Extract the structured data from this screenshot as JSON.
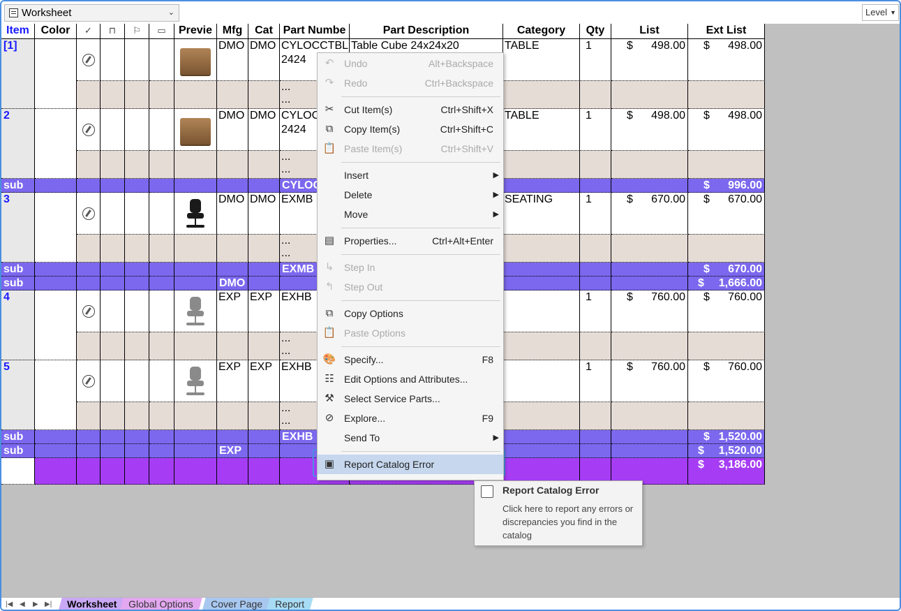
{
  "toolbar": {
    "sheet_name": "Worksheet",
    "level_label": "Level"
  },
  "columns": [
    "Item",
    "Color",
    "✓",
    "lock",
    "flag",
    "note",
    "Previe",
    "Mfg",
    "Cat",
    "Part Numbe",
    "Part Description",
    "Category",
    "Qty",
    "List",
    "Ext List"
  ],
  "rows": [
    {
      "item": "[1]",
      "mfg": "DMO",
      "cat": "DMO",
      "part": "CYLOCCTBL\n2424",
      "desc": "Table Cube 24x24x20",
      "category": "TABLE",
      "qty": "1",
      "list": "498.00",
      "ext": "498.00",
      "preview": "cube"
    },
    {
      "item": "2",
      "mfg": "DMO",
      "cat": "DMO",
      "part": "CYLOC\n2424",
      "desc": "",
      "category": "TABLE",
      "qty": "1",
      "list": "498.00",
      "ext": "498.00",
      "preview": "cube"
    },
    {
      "item": "3",
      "mfg": "DMO",
      "cat": "DMO",
      "part": "EXMB",
      "desc": "",
      "category": "SEATING",
      "qty": "1",
      "list": "670.00",
      "ext": "670.00",
      "preview": "black-chair"
    },
    {
      "item": "4",
      "mfg": "EXP",
      "cat": "EXP",
      "part": "EXHB",
      "desc": "",
      "category": "",
      "qty": "1",
      "list": "760.00",
      "ext": "760.00",
      "preview": "gray-chair"
    },
    {
      "item": "5",
      "mfg": "EXP",
      "cat": "EXP",
      "part": "EXHB",
      "desc": "",
      "category": "",
      "qty": "1",
      "list": "760.00",
      "ext": "760.00",
      "preview": "gray-chair"
    }
  ],
  "subtotals": {
    "s1": {
      "label": "sub",
      "part": "CYLOC",
      "ext": "996.00"
    },
    "s2": {
      "label": "sub",
      "part": "EXMB",
      "ext": "670.00"
    },
    "s3": {
      "label": "sub",
      "mfg": "DMO",
      "ext": "1,666.00"
    },
    "s4": {
      "label": "sub",
      "part": "EXHB",
      "ext": "1,520.00"
    },
    "s5": {
      "label": "sub",
      "mfg": "EXP",
      "ext": "1,520.00"
    },
    "total": {
      "ext": "3,186.00"
    }
  },
  "dollar": "$",
  "ellipsis": "...",
  "menu": {
    "undo": {
      "label": "Undo",
      "shortcut": "Alt+Backspace"
    },
    "redo": {
      "label": "Redo",
      "shortcut": "Ctrl+Backspace"
    },
    "cut": {
      "label": "Cut Item(s)",
      "shortcut": "Ctrl+Shift+X"
    },
    "copy": {
      "label": "Copy Item(s)",
      "shortcut": "Ctrl+Shift+C"
    },
    "paste": {
      "label": "Paste Item(s)",
      "shortcut": "Ctrl+Shift+V"
    },
    "insert": {
      "label": "Insert"
    },
    "delete": {
      "label": "Delete"
    },
    "move": {
      "label": "Move"
    },
    "properties": {
      "label": "Properties...",
      "shortcut": "Ctrl+Alt+Enter"
    },
    "step_in": {
      "label": "Step In"
    },
    "step_out": {
      "label": "Step Out"
    },
    "copy_options": {
      "label": "Copy Options"
    },
    "paste_options": {
      "label": "Paste Options"
    },
    "specify": {
      "label": "Specify...",
      "shortcut": "F8"
    },
    "edit_options": {
      "label": "Edit Options and Attributes..."
    },
    "service_parts": {
      "label": "Select Service Parts..."
    },
    "explore": {
      "label": "Explore...",
      "shortcut": "F9"
    },
    "send_to": {
      "label": "Send To"
    },
    "report": {
      "label": "Report Catalog Error"
    }
  },
  "tooltip": {
    "title": "Report Catalog Error",
    "body": "Click here to report any errors or discrepancies you find in the catalog"
  },
  "tabs": [
    {
      "label": "Worksheet",
      "color": "#c9a8f5",
      "active": true
    },
    {
      "label": "Global Options",
      "color": "#e3a8f0"
    },
    {
      "label": "Cover Page",
      "color": "#a8c8f0"
    },
    {
      "label": "Report",
      "color": "#a8dcf5"
    }
  ],
  "colors": {
    "subtotal": "#7b68ee",
    "total": "#a63df5",
    "item_text": "#1a1aff",
    "detail_band": "#e6dcd6"
  }
}
